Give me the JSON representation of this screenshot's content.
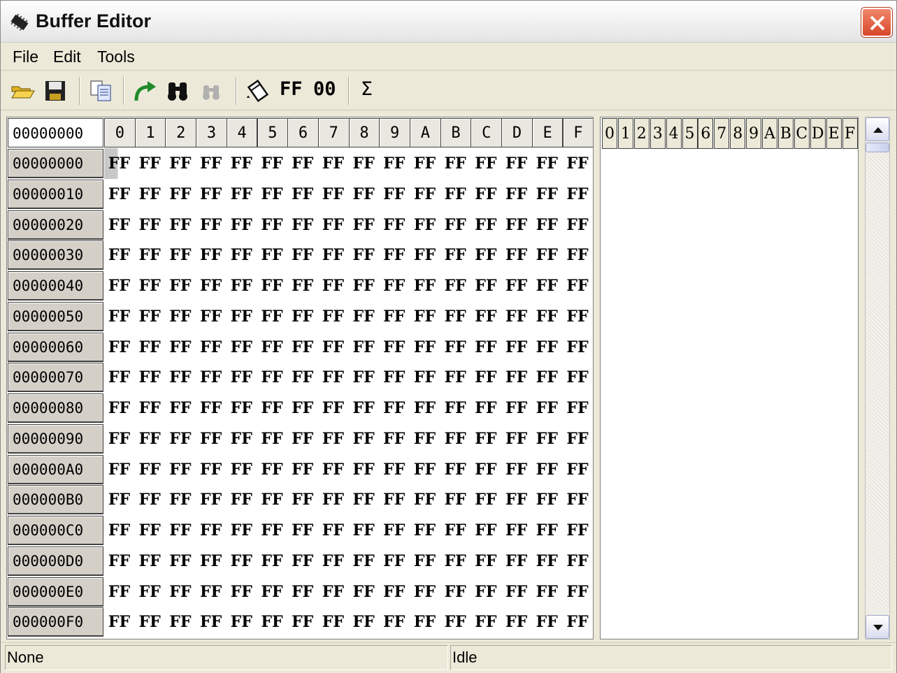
{
  "window": {
    "title": "Buffer Editor"
  },
  "menu": [
    {
      "label": "File"
    },
    {
      "label": "Edit"
    },
    {
      "label": "Tools"
    }
  ],
  "toolbar": {
    "fill_ff_label": "FF",
    "fill_00_label": "00",
    "checksum_label": "Σ",
    "icons": [
      "open-folder-icon",
      "save-icon",
      "copy-icon",
      "goto-icon",
      "find-icon",
      "find-next-icon",
      "fill-icon",
      "checksum-icon"
    ]
  },
  "hex": {
    "address_box": "00000000",
    "columns": [
      "0",
      "1",
      "2",
      "3",
      "4",
      "5",
      "6",
      "7",
      "8",
      "9",
      "A",
      "B",
      "C",
      "D",
      "E",
      "F"
    ],
    "rows": [
      {
        "addr": "00000000",
        "bytes": [
          "FF",
          "FF",
          "FF",
          "FF",
          "FF",
          "FF",
          "FF",
          "FF",
          "FF",
          "FF",
          "FF",
          "FF",
          "FF",
          "FF",
          "FF",
          "FF"
        ]
      },
      {
        "addr": "00000010",
        "bytes": [
          "FF",
          "FF",
          "FF",
          "FF",
          "FF",
          "FF",
          "FF",
          "FF",
          "FF",
          "FF",
          "FF",
          "FF",
          "FF",
          "FF",
          "FF",
          "FF"
        ]
      },
      {
        "addr": "00000020",
        "bytes": [
          "FF",
          "FF",
          "FF",
          "FF",
          "FF",
          "FF",
          "FF",
          "FF",
          "FF",
          "FF",
          "FF",
          "FF",
          "FF",
          "FF",
          "FF",
          "FF"
        ]
      },
      {
        "addr": "00000030",
        "bytes": [
          "FF",
          "FF",
          "FF",
          "FF",
          "FF",
          "FF",
          "FF",
          "FF",
          "FF",
          "FF",
          "FF",
          "FF",
          "FF",
          "FF",
          "FF",
          "FF"
        ]
      },
      {
        "addr": "00000040",
        "bytes": [
          "FF",
          "FF",
          "FF",
          "FF",
          "FF",
          "FF",
          "FF",
          "FF",
          "FF",
          "FF",
          "FF",
          "FF",
          "FF",
          "FF",
          "FF",
          "FF"
        ]
      },
      {
        "addr": "00000050",
        "bytes": [
          "FF",
          "FF",
          "FF",
          "FF",
          "FF",
          "FF",
          "FF",
          "FF",
          "FF",
          "FF",
          "FF",
          "FF",
          "FF",
          "FF",
          "FF",
          "FF"
        ]
      },
      {
        "addr": "00000060",
        "bytes": [
          "FF",
          "FF",
          "FF",
          "FF",
          "FF",
          "FF",
          "FF",
          "FF",
          "FF",
          "FF",
          "FF",
          "FF",
          "FF",
          "FF",
          "FF",
          "FF"
        ]
      },
      {
        "addr": "00000070",
        "bytes": [
          "FF",
          "FF",
          "FF",
          "FF",
          "FF",
          "FF",
          "FF",
          "FF",
          "FF",
          "FF",
          "FF",
          "FF",
          "FF",
          "FF",
          "FF",
          "FF"
        ]
      },
      {
        "addr": "00000080",
        "bytes": [
          "FF",
          "FF",
          "FF",
          "FF",
          "FF",
          "FF",
          "FF",
          "FF",
          "FF",
          "FF",
          "FF",
          "FF",
          "FF",
          "FF",
          "FF",
          "FF"
        ]
      },
      {
        "addr": "00000090",
        "bytes": [
          "FF",
          "FF",
          "FF",
          "FF",
          "FF",
          "FF",
          "FF",
          "FF",
          "FF",
          "FF",
          "FF",
          "FF",
          "FF",
          "FF",
          "FF",
          "FF"
        ]
      },
      {
        "addr": "000000A0",
        "bytes": [
          "FF",
          "FF",
          "FF",
          "FF",
          "FF",
          "FF",
          "FF",
          "FF",
          "FF",
          "FF",
          "FF",
          "FF",
          "FF",
          "FF",
          "FF",
          "FF"
        ]
      },
      {
        "addr": "000000B0",
        "bytes": [
          "FF",
          "FF",
          "FF",
          "FF",
          "FF",
          "FF",
          "FF",
          "FF",
          "FF",
          "FF",
          "FF",
          "FF",
          "FF",
          "FF",
          "FF",
          "FF"
        ]
      },
      {
        "addr": "000000C0",
        "bytes": [
          "FF",
          "FF",
          "FF",
          "FF",
          "FF",
          "FF",
          "FF",
          "FF",
          "FF",
          "FF",
          "FF",
          "FF",
          "FF",
          "FF",
          "FF",
          "FF"
        ]
      },
      {
        "addr": "000000D0",
        "bytes": [
          "FF",
          "FF",
          "FF",
          "FF",
          "FF",
          "FF",
          "FF",
          "FF",
          "FF",
          "FF",
          "FF",
          "FF",
          "FF",
          "FF",
          "FF",
          "FF"
        ]
      },
      {
        "addr": "000000E0",
        "bytes": [
          "FF",
          "FF",
          "FF",
          "FF",
          "FF",
          "FF",
          "FF",
          "FF",
          "FF",
          "FF",
          "FF",
          "FF",
          "FF",
          "FF",
          "FF",
          "FF"
        ]
      },
      {
        "addr": "000000F0",
        "bytes": [
          "FF",
          "FF",
          "FF",
          "FF",
          "FF",
          "FF",
          "FF",
          "FF",
          "FF",
          "FF",
          "FF",
          "FF",
          "FF",
          "FF",
          "FF",
          "FF"
        ]
      }
    ]
  },
  "ascii": {
    "columns": [
      "0",
      "1",
      "2",
      "3",
      "4",
      "5",
      "6",
      "7",
      "8",
      "9",
      "A",
      "B",
      "C",
      "D",
      "E",
      "F"
    ]
  },
  "status": {
    "left": "None",
    "right": "Idle"
  },
  "colors": {
    "close_button": "#d7472a",
    "window_face": "#ece9d8",
    "header_face": "#d4d0c8"
  }
}
